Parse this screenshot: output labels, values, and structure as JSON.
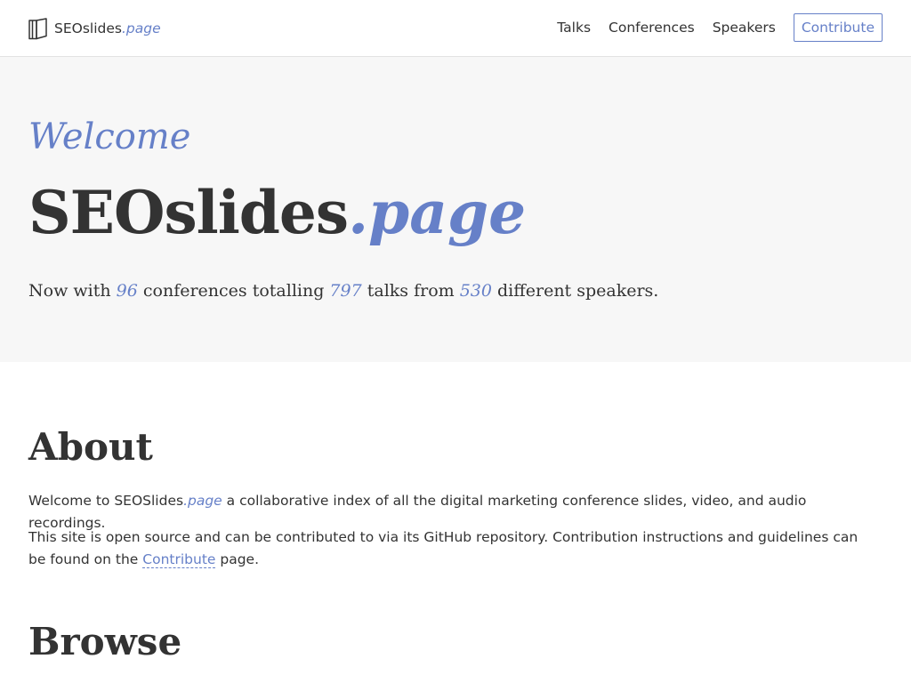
{
  "colors": {
    "accent": "#6680c8",
    "text": "#333333",
    "hero_background": "#f7f7f7",
    "page_background": "#ffffff"
  },
  "navbar": {
    "brand": {
      "icon": "slides-book-icon",
      "name": "SEOslides",
      "tld": ".page"
    },
    "links": [
      "Talks",
      "Conferences",
      "Speakers"
    ],
    "cta_label": "Contribute"
  },
  "hero": {
    "welcome": "Welcome",
    "title_main": "SEOslides",
    "title_tld": ".page",
    "stats": {
      "prefix": "Now with",
      "conferences": "96",
      "mid1": "conferences totalling",
      "talks": "797",
      "mid2": "talks from",
      "speakers": "530",
      "suffix": "different speakers."
    }
  },
  "about": {
    "heading": "About",
    "p1": {
      "start": "Welcome to SEOSlides",
      "tld": ".page",
      "rest": "a collaborative index of all the digital marketing conference slides, video, and audio recordings."
    },
    "p2": {
      "start": "This site is open source and can be contributed to via its GitHub repository. Contribution instructions and guidelines can be found on the",
      "link": "Contribute",
      "end": "page."
    }
  },
  "browse": {
    "heading": "Browse"
  }
}
